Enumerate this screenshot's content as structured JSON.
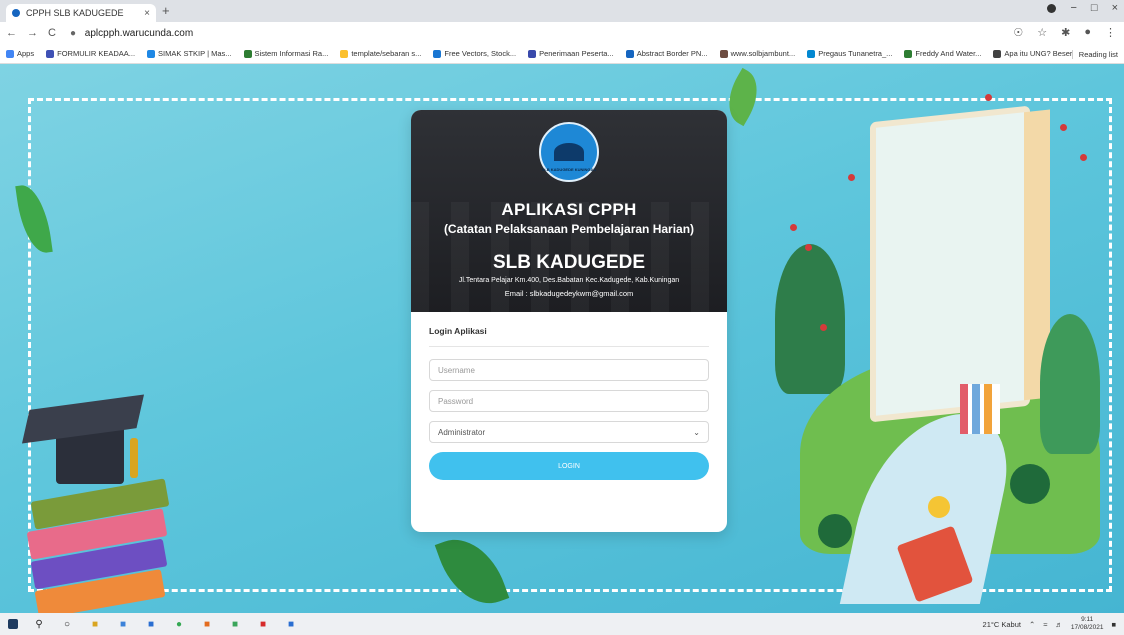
{
  "browser": {
    "tab_title": "CPPH SLB KADUGEDE",
    "tab_close": "×",
    "new_tab": "+",
    "url": "aplcpph.warucunda.com",
    "nav_back": "←",
    "nav_forward": "→",
    "nav_reload": "C",
    "window_min": "−",
    "window_max": "□",
    "window_close": "×",
    "bookmarks": [
      {
        "label": "Apps",
        "color": "#4285f4"
      },
      {
        "label": "FORMULIR KEADAA...",
        "color": "#3f51b5"
      },
      {
        "label": "SIMAK STKIP | Mas...",
        "color": "#1e88e5"
      },
      {
        "label": "Sistem Informasi Ra...",
        "color": "#2e7d32"
      },
      {
        "label": "template/sebaran s...",
        "color": "#fbc02d"
      },
      {
        "label": "Free Vectors, Stock...",
        "color": "#1976d2"
      },
      {
        "label": "Penerimaan Peserta...",
        "color": "#3949ab"
      },
      {
        "label": "Abstract Border PN...",
        "color": "#1565c0"
      },
      {
        "label": "www.solbjambunt...",
        "color": "#6d4c41"
      },
      {
        "label": "Pregaus Tunanetra_...",
        "color": "#0288d1"
      },
      {
        "label": "Freddy And Water...",
        "color": "#2e7d32"
      },
      {
        "label": "Apa itu UNG? Beser...",
        "color": "#424242"
      }
    ],
    "reading_list": "Reading list"
  },
  "card": {
    "title": "APLIKASI CPPH",
    "subtitle": "(Catatan Pelaksanaan Pembelajaran Harian)",
    "school": "SLB KADUGEDE",
    "address": "Jl.Tentara Pelajar Km.400, Des.Babatan Kec.Kadugede, Kab.Kuningan",
    "email": "Email : slbkadugedeykwm@gmail.com",
    "logo_text": "SLB KADUGEDE KUNINGAN"
  },
  "form": {
    "heading": "Login Aplikasi",
    "username_placeholder": "Username",
    "password_placeholder": "Password",
    "role_selected": "Administrator",
    "login_label": "LOGIN"
  },
  "taskbar": {
    "weather": "21°C Kabut",
    "time": "9:11",
    "date": "17/08/2021"
  },
  "colors": {
    "accent": "#40c1ee",
    "background": "#5ec6dc"
  }
}
